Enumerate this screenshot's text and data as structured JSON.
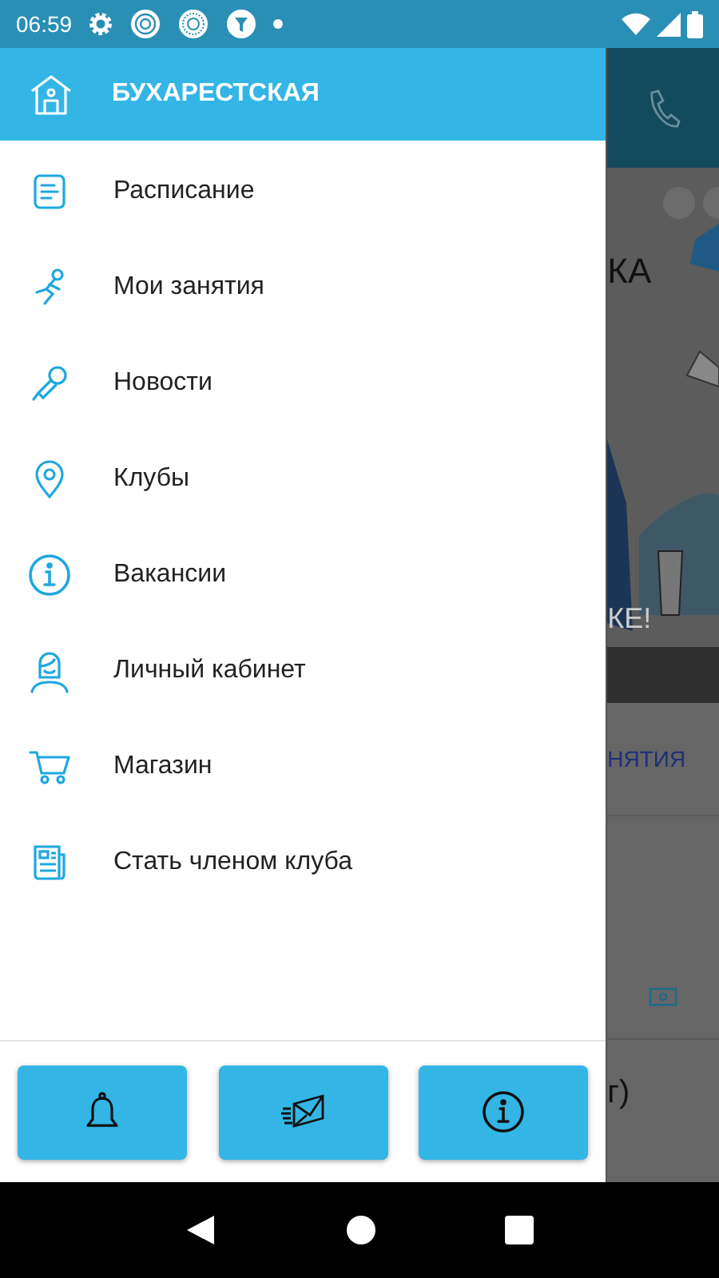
{
  "status_bar": {
    "time": "06:59"
  },
  "drawer": {
    "header": {
      "title": "БУХАРЕСТСКАЯ"
    },
    "items": [
      {
        "label": "Расписание",
        "kind": "schedule"
      },
      {
        "label": "Мои занятия",
        "kind": "runner"
      },
      {
        "label": "Новости",
        "kind": "microphone"
      },
      {
        "label": "Клубы",
        "kind": "pin"
      },
      {
        "label": "Вакансии",
        "kind": "info"
      },
      {
        "label": "Личный кабинет",
        "kind": "person"
      },
      {
        "label": "Магазин",
        "kind": "cart"
      },
      {
        "label": "Стать членом клуба",
        "kind": "newspaper"
      }
    ],
    "buttons": [
      {
        "kind": "bell"
      },
      {
        "kind": "mail"
      },
      {
        "kind": "info"
      }
    ]
  },
  "background": {
    "banner_texts": [
      "КА",
      "КЕ!"
    ],
    "tab": "НЯТИЯ",
    "text_fragment": "г)"
  }
}
